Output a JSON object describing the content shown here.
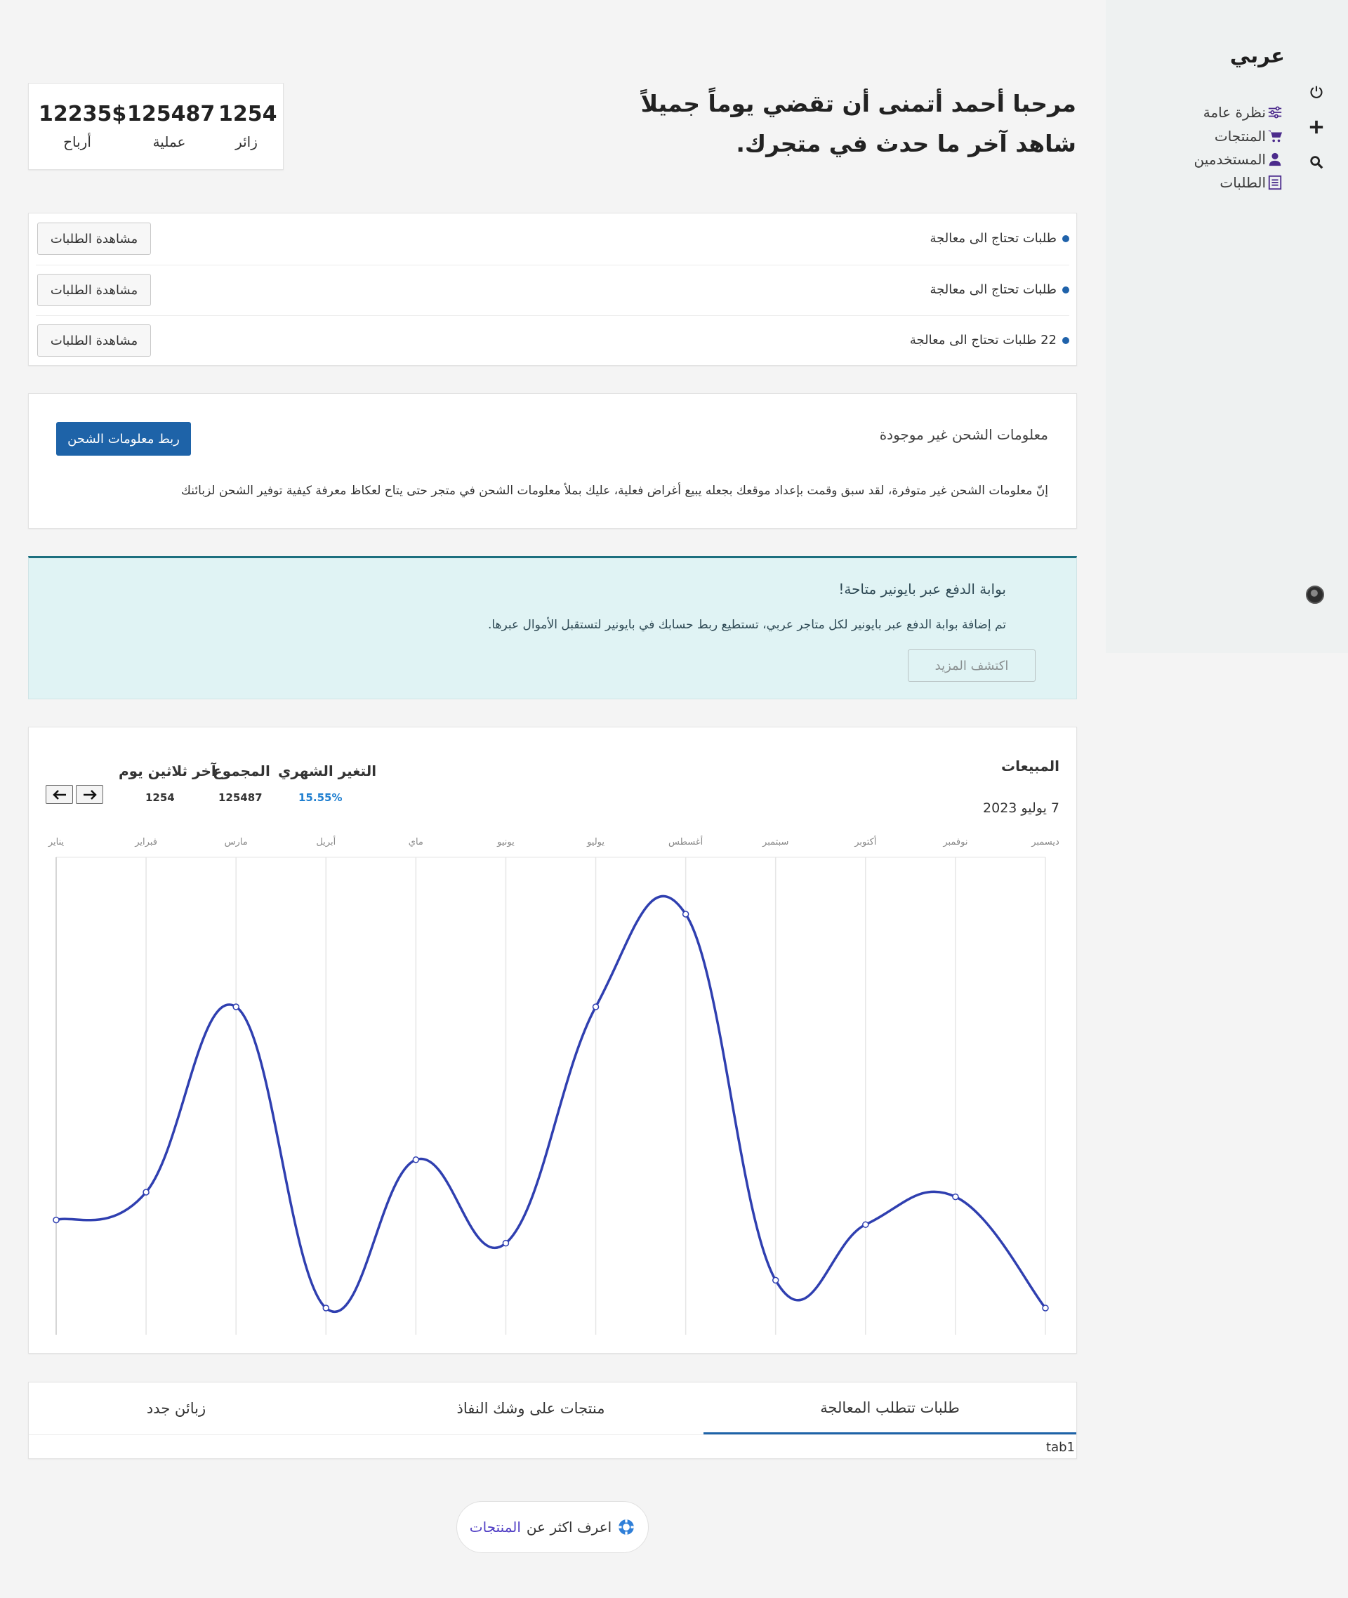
{
  "sidebar": {
    "brand": "عربي",
    "items": [
      {
        "label": "نظرة عامة",
        "icon": "sliders-icon"
      },
      {
        "label": "المنتجات",
        "icon": "cart-icon"
      },
      {
        "label": "المستخدمين",
        "icon": "user-icon"
      },
      {
        "label": "الطلبات",
        "icon": "list-icon"
      }
    ],
    "rail_icons": [
      "power-icon",
      "plus-icon",
      "search-icon",
      "avatar"
    ]
  },
  "header": {
    "line1": "مرحبا أحمد أتمنى أن تقضي يوماً جميلاً",
    "line2": "شاهد آخر ما حدث في متجرك."
  },
  "stats": [
    {
      "value": "1254",
      "label": "زائر"
    },
    {
      "value": "125487",
      "label": "عملية"
    },
    {
      "value": "12235$",
      "label": "أرباح"
    }
  ],
  "orders": [
    {
      "text": "طلبات تحتاج الى معالجة",
      "button": "مشاهدة الطلبات"
    },
    {
      "text": "طلبات تحتاج الى معالجة",
      "button": "مشاهدة الطلبات"
    },
    {
      "text": "22 طلبات تحتاج الى معالجة",
      "button": "مشاهدة الطلبات"
    }
  ],
  "shipping": {
    "title": "معلومات الشحن غير موجودة",
    "button": "ربط معلومات الشحن",
    "body": "إنّ معلومات الشحن غير متوفرة، لقد سبق وقمت بإعداد موقعك بجعله يبيع أغراض فعلية، عليك بملأ معلومات الشحن في متجر حتى يتاح لعكاظ معرفة كيفية توفير الشحن لزبائنك"
  },
  "payoneer": {
    "title": "بوابة الدفع عبر بايونير متاحة!",
    "body": "تم إضافة بوابة الدفع عبر بايونير لكل متاجر عربي، تستطيع ربط حسابك في بايونير لتستقبل الأموال عبرها.",
    "button": "اكتشف المزيد"
  },
  "sales": {
    "title": "المبيعات",
    "date": "7 يوليو 2023",
    "metrics": [
      {
        "label": "التغير الشهري",
        "value": "15.55%",
        "color": "#1f7fd0"
      },
      {
        "label": "المجموع",
        "value": "125487",
        "color": "#333333"
      },
      {
        "label": "آخر ثلاثين يوم",
        "value": "1254",
        "color": "#333333"
      }
    ],
    "line_color": "#2f3fb0"
  },
  "chart_data": {
    "type": "line",
    "categories": [
      "يناير",
      "فبراير",
      "مارس",
      "أبريل",
      "ماي",
      "يونيو",
      "يوليو",
      "أغسطس",
      "سبتمبر",
      "أكتوبر",
      "نوفمبر",
      "ديسمبر"
    ],
    "values": [
      24,
      30,
      70,
      5,
      37,
      19,
      70,
      90,
      11,
      23,
      29,
      5
    ],
    "ylim": [
      0,
      100
    ],
    "grid": "vertical",
    "legend": "none"
  },
  "tabs": {
    "items": [
      "طلبات تتطلب المعالجة",
      "منتجات على وشك النفاذ",
      "زبائن جدد"
    ],
    "active": 0,
    "content": "tab1"
  },
  "learn_more": {
    "prefix": "اعرف اكثر عن",
    "link": "المنتجات",
    "icon": "lifebuoy-icon"
  }
}
